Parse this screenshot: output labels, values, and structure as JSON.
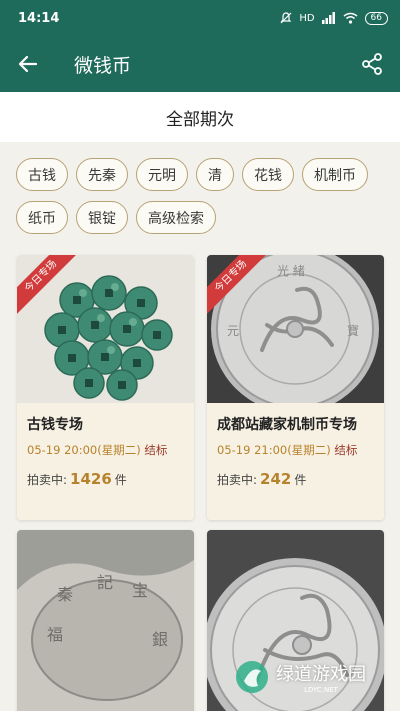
{
  "status_bar": {
    "time": "14:14",
    "signal_text": "HD",
    "battery": "66"
  },
  "app_bar": {
    "title": "微钱币",
    "back_icon": "back-arrow-icon",
    "share_icon": "share-icon"
  },
  "section": {
    "title": "全部期次"
  },
  "chips": [
    "古钱",
    "先秦",
    "元明",
    "清",
    "花钱",
    "机制币",
    "纸币",
    "银锭",
    "高级检索"
  ],
  "cards": [
    {
      "ribbon": "今日专场",
      "title": "古钱专场",
      "time": "05-19 20:00(星期二)",
      "end_label": "结标",
      "count_label": "拍卖中:",
      "count": "1426",
      "unit": "件"
    },
    {
      "ribbon": "今日专场",
      "title": "成都站藏家机制币专场",
      "time": "05-19 21:00(星期二)",
      "end_label": "结标",
      "count_label": "拍卖中:",
      "count": "242",
      "unit": "件"
    },
    {
      "title": "",
      "image": "silver-ingot"
    },
    {
      "title": "",
      "image": "dragon-silver-dollar"
    }
  ],
  "watermark": {
    "text": "绿道游戏园",
    "sub": "LDYC.NET"
  },
  "colors": {
    "primary": "#1f6b5b",
    "chip_border": "#b8a275",
    "accent": "#b7822c",
    "ribbon": "#d23b3b"
  }
}
